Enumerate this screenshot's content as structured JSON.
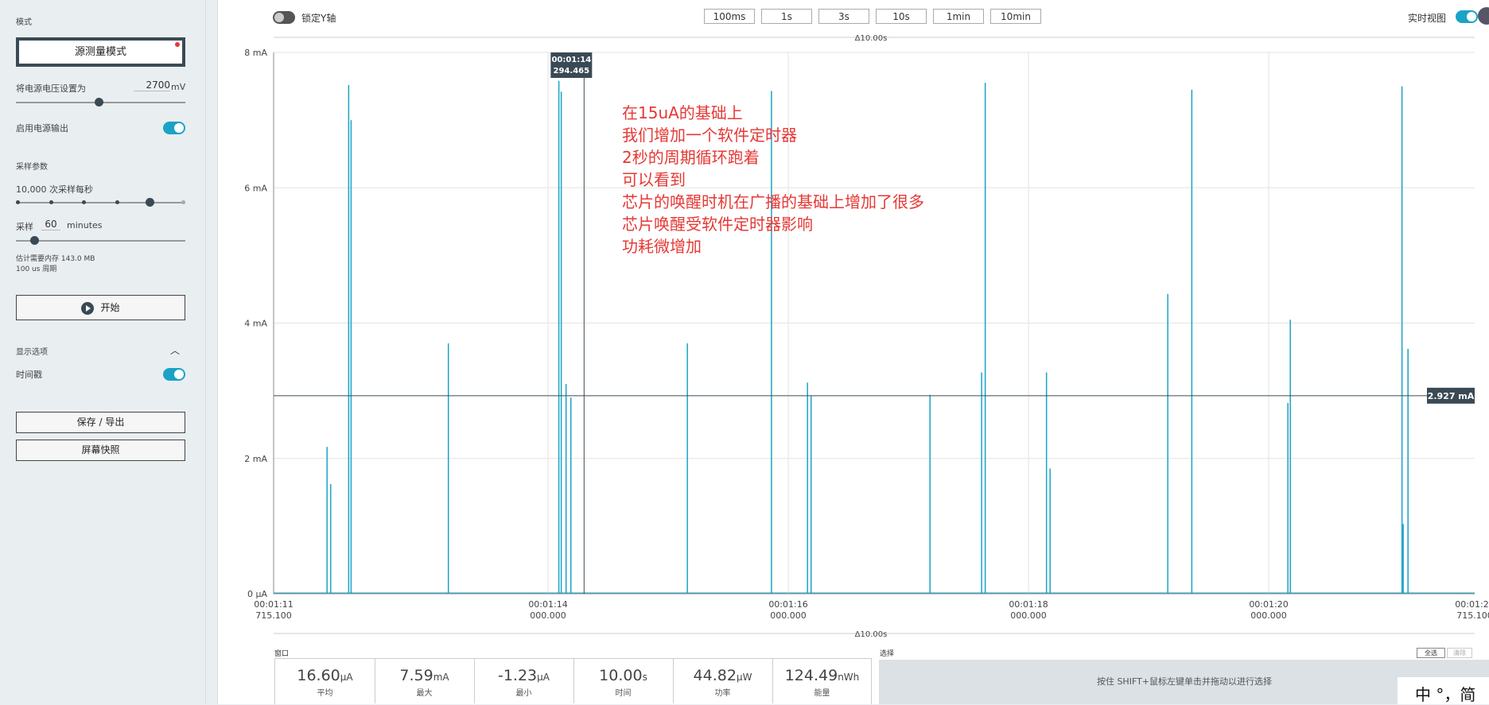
{
  "sidebar": {
    "mode_heading": "模式",
    "mode_button": "源测量模式",
    "voltage_label": "将电源电压设置为",
    "voltage_value": "2700",
    "voltage_unit": "mV",
    "power_output_label": "启用电源输出",
    "power_output_enabled": true,
    "sampling_heading": "采样参数",
    "sample_rate_label": "10,000 次采样每秒",
    "sample_rate_steps": 6,
    "sample_rate_selected_step": 4,
    "duration_prefix": "采样",
    "duration_value": "60",
    "duration_unit": "minutes",
    "memory_estimate": "估计需要内存 143.0 MB",
    "period": "100 us 周期",
    "start_button": "开始",
    "display_heading": "显示选项",
    "timestamp_label": "时间戳",
    "timestamp_enabled": true,
    "save_export_button": "保存 / 导出",
    "screenshot_button": "屏幕快照"
  },
  "toolbar": {
    "lock_y_label": "锁定Y轴",
    "lock_y_enabled": false,
    "time_buttons": [
      "100ms",
      "1s",
      "3s",
      "10s",
      "1min",
      "10min"
    ],
    "realtime_label": "实时视图",
    "realtime_enabled": true,
    "delta_top": "Δ10.00s",
    "delta_bottom": "Δ10.00s"
  },
  "chart_data": {
    "type": "line",
    "y_unit": "mA",
    "ylim": [
      0,
      8
    ],
    "y_ticks": [
      "0 μA",
      "2 mA",
      "4 mA",
      "6 mA",
      "8 mA"
    ],
    "xlim_seconds": [
      71.7151,
      81.7151
    ],
    "x_ticks": [
      {
        "t": 71.7151,
        "l1": "00:01:11",
        "l2": "715.100"
      },
      {
        "t": 74.0,
        "l1": "00:01:14",
        "l2": "000.000"
      },
      {
        "t": 76.0,
        "l1": "00:01:16",
        "l2": "000.000"
      },
      {
        "t": 78.0,
        "l1": "00:01:18",
        "l2": "000.000"
      },
      {
        "t": 80.0,
        "l1": "00:01:20",
        "l2": "000.000"
      },
      {
        "t": 81.7151,
        "l1": "00:01:21",
        "l2": "715.100"
      }
    ],
    "spikes": [
      {
        "t": 72.16,
        "v": 2.17
      },
      {
        "t": 72.19,
        "v": 1.62
      },
      {
        "t": 72.34,
        "v": 7.52
      },
      {
        "t": 72.36,
        "v": 7.0
      },
      {
        "t": 73.17,
        "v": 3.7
      },
      {
        "t": 74.09,
        "v": 7.58
      },
      {
        "t": 74.11,
        "v": 7.42
      },
      {
        "t": 74.15,
        "v": 3.1
      },
      {
        "t": 74.19,
        "v": 2.9
      },
      {
        "t": 75.16,
        "v": 3.7
      },
      {
        "t": 75.86,
        "v": 7.43
      },
      {
        "t": 76.16,
        "v": 3.12
      },
      {
        "t": 76.19,
        "v": 2.92
      },
      {
        "t": 77.18,
        "v": 2.94
      },
      {
        "t": 77.61,
        "v": 3.27
      },
      {
        "t": 77.64,
        "v": 7.55
      },
      {
        "t": 78.15,
        "v": 3.27
      },
      {
        "t": 78.18,
        "v": 1.85
      },
      {
        "t": 79.16,
        "v": 4.43
      },
      {
        "t": 79.36,
        "v": 7.45
      },
      {
        "t": 80.16,
        "v": 2.82
      },
      {
        "t": 80.18,
        "v": 4.05
      },
      {
        "t": 81.11,
        "v": 7.5
      },
      {
        "t": 81.12,
        "v": 1.03
      },
      {
        "t": 81.16,
        "v": 3.62
      }
    ],
    "cursor": {
      "t": 74.3,
      "time_label": "00:01:14",
      "value_label": "294.465"
    },
    "avg_line": {
      "v": 2.927,
      "label": "2.927 mA"
    },
    "color": "#1ba3c6",
    "grid": true
  },
  "annotation": [
    "在15uA的基础上",
    "我们增加一个软件定时器",
    "2秒的周期循环跑着",
    "可以看到",
    "芯片的唤醒时机在广播的基础上增加了很多",
    "芯片唤醒受软件定时器影响",
    "功耗微增加"
  ],
  "stats": {
    "window_label": "窗口",
    "items": [
      {
        "value": "16.60",
        "unit": "μA",
        "label": "平均"
      },
      {
        "value": "7.59",
        "unit": "mA",
        "label": "最大"
      },
      {
        "value": "-1.23",
        "unit": "μA",
        "label": "最小"
      },
      {
        "value": "10.00",
        "unit": "s",
        "label": "时间"
      },
      {
        "value": "44.82",
        "unit": "μW",
        "label": "功率"
      },
      {
        "value": "124.49",
        "unit": "nWh",
        "label": "能量"
      }
    ]
  },
  "selection": {
    "label": "选择",
    "select_all_button": "全选",
    "clear_button": "清除",
    "hint": "按住 SHIFT+鼠标左键单击并拖动以进行选择"
  },
  "ime": "中 °，简"
}
